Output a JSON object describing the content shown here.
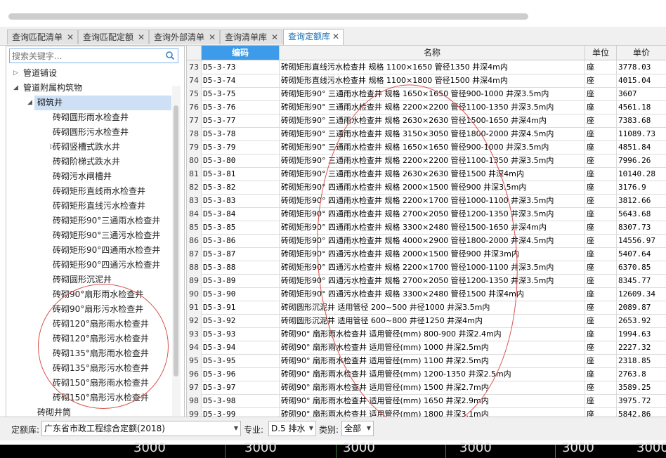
{
  "tabs": [
    {
      "label": "查询匹配清单"
    },
    {
      "label": "查询匹配定额"
    },
    {
      "label": "查询外部清单"
    },
    {
      "label": "查询清单库"
    },
    {
      "label": "查询定额库"
    }
  ],
  "search": {
    "placeholder": "搜索关键字..."
  },
  "tree": [
    {
      "label": "管道铺设",
      "level": 0,
      "arrow": "▷"
    },
    {
      "label": "管道附属构筑物",
      "level": 0,
      "arrow": "◢"
    },
    {
      "label": "砌筑井",
      "level": 1,
      "arrow": "◢",
      "selected": true
    },
    {
      "label": "砖砌圆形雨水检查井",
      "level": 2,
      "arrow": ""
    },
    {
      "label": "砖砌圆形污水检查井",
      "level": 2,
      "arrow": ""
    },
    {
      "label": "砖砌竖槽式跌水井",
      "level": 2,
      "arrow": "▷"
    },
    {
      "label": "砖砌阶梯式跌水井",
      "level": 2,
      "arrow": ""
    },
    {
      "label": "砖砌污水闸槽井",
      "level": 2,
      "arrow": ""
    },
    {
      "label": "砖砌矩形直线雨水检查井",
      "level": 2,
      "arrow": ""
    },
    {
      "label": "砖砌矩形直线污水检查井",
      "level": 2,
      "arrow": ""
    },
    {
      "label": "砖砌矩形90°三通雨水检查井",
      "level": 2,
      "arrow": ""
    },
    {
      "label": "砖砌矩形90°三通污水检查井",
      "level": 2,
      "arrow": ""
    },
    {
      "label": "砖砌矩形90°四通雨水检查井",
      "level": 2,
      "arrow": ""
    },
    {
      "label": "砖砌矩形90°四通污水检查井",
      "level": 2,
      "arrow": ""
    },
    {
      "label": "砖砌圆形沉泥井",
      "level": 2,
      "arrow": ""
    },
    {
      "label": "砖砌90°扇形雨水检查井",
      "level": 2,
      "arrow": ""
    },
    {
      "label": "砖砌90°扇形污水检查井",
      "level": 2,
      "arrow": ""
    },
    {
      "label": "砖砌120°扇形雨水检查井",
      "level": 2,
      "arrow": ""
    },
    {
      "label": "砖砌120°扇形污水检查井",
      "level": 2,
      "arrow": ""
    },
    {
      "label": "砖砌135°扇形雨水检查井",
      "level": 2,
      "arrow": ""
    },
    {
      "label": "砖砌135°扇形污水检查井",
      "level": 2,
      "arrow": ""
    },
    {
      "label": "砖砌150°扇形雨水检查井",
      "level": 2,
      "arrow": ""
    },
    {
      "label": "砖砌150°扇形污水检查井",
      "level": 2,
      "arrow": ""
    },
    {
      "label": "砖砌井筒",
      "level": 1,
      "arrow": ""
    }
  ],
  "grid": {
    "headers": {
      "code": "编码",
      "name": "名称",
      "unit": "单位",
      "price": "单价"
    },
    "rows": [
      {
        "n": "73",
        "code": "D5-3-73",
        "name": "砖砌矩形直线污水检查井 规格 1100×1650 管径1350 井深4m内",
        "unit": "座",
        "price": "3778.03"
      },
      {
        "n": "74",
        "code": "D5-3-74",
        "name": "砖砌矩形直线污水检查井 规格 1100×1800 管径1500 井深4m内",
        "unit": "座",
        "price": "4015.04"
      },
      {
        "n": "75",
        "code": "D5-3-75",
        "name": "砖砌矩形90° 三通雨水检查井 规格 1650×1650 管径900-1000 井深3.5m内",
        "unit": "座",
        "price": "3607"
      },
      {
        "n": "76",
        "code": "D5-3-76",
        "name": "砖砌矩形90° 三通雨水检查井 规格 2200×2200 管径1100-1350 井深3.5m内",
        "unit": "座",
        "price": "4561.18"
      },
      {
        "n": "77",
        "code": "D5-3-77",
        "name": "砖砌矩形90° 三通雨水检查井 规格 2630×2630 管径1500-1650 井深4m内",
        "unit": "座",
        "price": "7383.68"
      },
      {
        "n": "78",
        "code": "D5-3-78",
        "name": "砖砌矩形90° 三通雨水检查井 规格 3150×3050 管径1800-2000 井深4.5m内",
        "unit": "座",
        "price": "11089.73"
      },
      {
        "n": "79",
        "code": "D5-3-79",
        "name": "砖砌矩形90° 三通雨水检查井 规格 1650×1650 管径900-1000 井深3.5m内",
        "unit": "座",
        "price": "4851.84"
      },
      {
        "n": "80",
        "code": "D5-3-80",
        "name": "砖砌矩形90° 三通雨水检查井 规格 2200×2200 管径1100-1350 井深3.5m内",
        "unit": "座",
        "price": "7996.26"
      },
      {
        "n": "81",
        "code": "D5-3-81",
        "name": "砖砌矩形90° 三通雨水检查井 规格 2630×2630 管径1500 井深4m内",
        "unit": "座",
        "price": "10140.28"
      },
      {
        "n": "82",
        "code": "D5-3-82",
        "name": "砖砌矩形90° 四通雨水检查井 规格 2000×1500 管径900 井深3.5m内",
        "unit": "座",
        "price": "3176.9"
      },
      {
        "n": "83",
        "code": "D5-3-83",
        "name": "砖砌矩形90° 四通雨水检查井 规格 2200×1700 管径1000-1100 井深3.5m内",
        "unit": "座",
        "price": "3812.66"
      },
      {
        "n": "84",
        "code": "D5-3-84",
        "name": "砖砌矩形90° 四通雨水检查井 规格 2700×2050 管径1200-1350 井深3.5m内",
        "unit": "座",
        "price": "5643.68"
      },
      {
        "n": "85",
        "code": "D5-3-85",
        "name": "砖砌矩形90° 四通雨水检查井 规格 3300×2480 管径1500-1650 井深4m内",
        "unit": "座",
        "price": "8307.73"
      },
      {
        "n": "86",
        "code": "D5-3-86",
        "name": "砖砌矩形90° 四通雨水检查井 规格 4000×2900 管径1800-2000 井深4.5m内",
        "unit": "座",
        "price": "14556.97"
      },
      {
        "n": "87",
        "code": "D5-3-87",
        "name": "砖砌矩形90° 四通污水检查井 规格 2000×1500 管径900 井深3m内",
        "unit": "座",
        "price": "5407.64"
      },
      {
        "n": "88",
        "code": "D5-3-88",
        "name": "砖砌矩形90° 四通污水检查井 规格 2200×1700 管径1000-1100 井深3.5m内",
        "unit": "座",
        "price": "6370.85"
      },
      {
        "n": "89",
        "code": "D5-3-89",
        "name": "砖砌矩形90° 四通污水检查井 规格 2700×2050 管径1200-1350 井深3.5m内",
        "unit": "座",
        "price": "8345.77"
      },
      {
        "n": "90",
        "code": "D5-3-90",
        "name": "砖砌矩形90° 四通污水检查井 规格 3300×2480 管径1500 井深4m内",
        "unit": "座",
        "price": "12609.34"
      },
      {
        "n": "91",
        "code": "D5-3-91",
        "name": "砖砌圆形沉泥井 适用管径 200~500 井径1000 井深3.5m内",
        "unit": "座",
        "price": "2089.87"
      },
      {
        "n": "92",
        "code": "D5-3-92",
        "name": "砖砌圆形沉泥井 适用管径 600~800 井径1250 井深4m内",
        "unit": "座",
        "price": "2653.92"
      },
      {
        "n": "93",
        "code": "D5-3-93",
        "name": "砖砌90° 扇形雨水检查井 适用管径(mm) 800-900 井深2.4m内",
        "unit": "座",
        "price": "1994.63"
      },
      {
        "n": "94",
        "code": "D5-3-94",
        "name": "砖砌90° 扇形雨水检查井 适用管径(mm) 1000 井深2.5m内",
        "unit": "座",
        "price": "2227.32"
      },
      {
        "n": "95",
        "code": "D5-3-95",
        "name": "砖砌90° 扇形雨水检查井 适用管径(mm) 1100 井深2.5m内",
        "unit": "座",
        "price": "2318.85"
      },
      {
        "n": "96",
        "code": "D5-3-96",
        "name": "砖砌90° 扇形雨水检查井 适用管径(mm) 1200-1350 井深2.5m内",
        "unit": "座",
        "price": "2763.8"
      },
      {
        "n": "97",
        "code": "D5-3-97",
        "name": "砖砌90° 扇形雨水检查井 适用管径(mm) 1500 井深2.7m内",
        "unit": "座",
        "price": "3589.25"
      },
      {
        "n": "98",
        "code": "D5-3-98",
        "name": "砖砌90° 扇形雨水检查井 适用管径(mm) 1650 井深2.9m内",
        "unit": "座",
        "price": "3975.72"
      },
      {
        "n": "99",
        "code": "D5-3-99",
        "name": "砖砌90° 扇形雨水检查井 适用管径(mm) 1800 井深3.1m内",
        "unit": "座",
        "price": "5842.86"
      }
    ]
  },
  "bottom": {
    "quota_label": "定额库:",
    "quota_value": "广东省市政工程综合定额(2018)",
    "major_label": "专业:",
    "major_value": "D.5 排水",
    "category_label": "类别:",
    "category_value": "全部"
  },
  "footer": {
    "numbers": [
      "3000",
      "3000",
      "3000",
      "3000",
      "3000",
      "3000"
    ]
  },
  "colors": {
    "accent": "#3d9be9",
    "selected": "#cde0f5",
    "annotation": "#d9534f"
  }
}
